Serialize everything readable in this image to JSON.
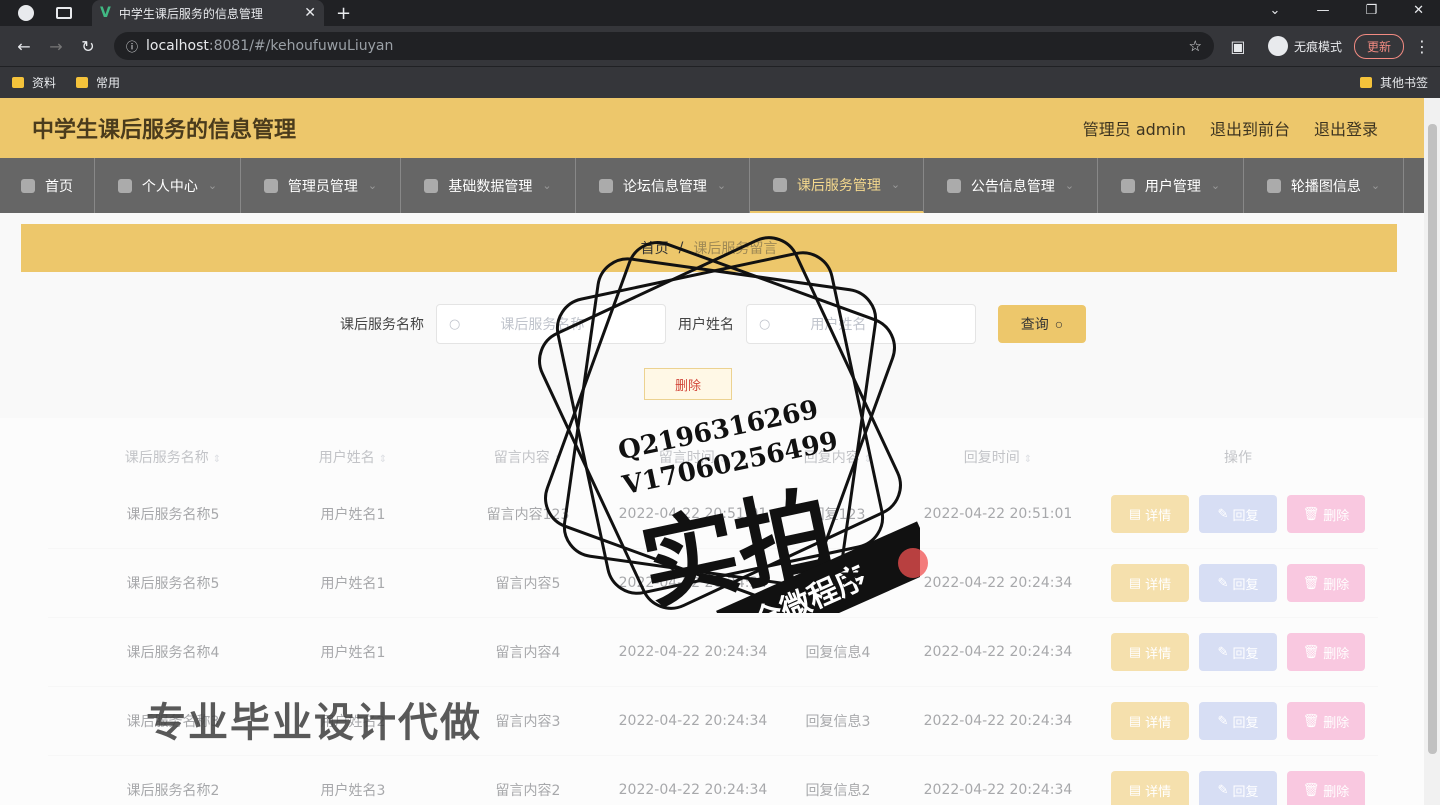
{
  "browser": {
    "tab_title": "中学生课后服务的信息管理",
    "url_host": "localhost",
    "url_rest": ":8081/#/kehoufuwuLiuyan",
    "incognito_label": "无痕模式",
    "update_label": "更新",
    "bookmarks": [
      "资料",
      "常用"
    ],
    "other_bookmarks": "其他书签"
  },
  "header": {
    "title": "中学生课后服务的信息管理",
    "admin": "管理员 admin",
    "to_front": "退出到前台",
    "logout": "退出登录"
  },
  "menu": [
    {
      "label": "首页",
      "icon": "home-icon"
    },
    {
      "label": "个人中心",
      "icon": "user-icon"
    },
    {
      "label": "管理员管理",
      "icon": "send-icon"
    },
    {
      "label": "基础数据管理",
      "icon": "navigation-icon"
    },
    {
      "label": "论坛信息管理",
      "icon": "list-icon"
    },
    {
      "label": "课后服务管理",
      "icon": "compass-icon"
    },
    {
      "label": "公告信息管理",
      "icon": "message-icon"
    },
    {
      "label": "用户管理",
      "icon": "check-square-icon"
    },
    {
      "label": "轮播图信息",
      "icon": "microphone-icon"
    }
  ],
  "breadcrumb": {
    "home": "首页",
    "sep": "/",
    "current": "课后服务留言"
  },
  "search": {
    "label1": "课后服务名称",
    "placeholder1": "课后服务名称",
    "label2": "用户姓名",
    "placeholder2": "用户姓名",
    "button": "查询"
  },
  "add_button": "删除",
  "table": {
    "headers": [
      "课后服务名称",
      "用户姓名",
      "留言内容",
      "留言时间",
      "回复内容",
      "回复时间",
      "操作"
    ],
    "rows": [
      [
        "课后服务名称5",
        "用户姓名1",
        "留言内容123",
        "2022-04-22 20:51:01",
        "回复123",
        "2022-04-22 20:51:01"
      ],
      [
        "课后服务名称5",
        "用户姓名1",
        "留言内容5",
        "2022-04-22 20:24:34",
        "回复信息5",
        "2022-04-22 20:24:34"
      ],
      [
        "课后服务名称4",
        "用户姓名1",
        "留言内容4",
        "2022-04-22 20:24:34",
        "回复信息4",
        "2022-04-22 20:24:34"
      ],
      [
        "课后服务名称3",
        "用户姓名2",
        "留言内容3",
        "2022-04-22 20:24:34",
        "回复信息3",
        "2022-04-22 20:24:34"
      ],
      [
        "课后服务名称2",
        "用户姓名3",
        "留言内容2",
        "2022-04-22 20:24:34",
        "回复信息2",
        "2022-04-22 20:24:34"
      ]
    ],
    "ops": {
      "detail": "详情",
      "reply": "回复",
      "delete": "删除"
    }
  },
  "watermark": {
    "line1": "Q2196316269",
    "line2": "V17060256499",
    "big": "实拍",
    "banner": "全微程序",
    "bottom": "专业毕业设计代做"
  }
}
